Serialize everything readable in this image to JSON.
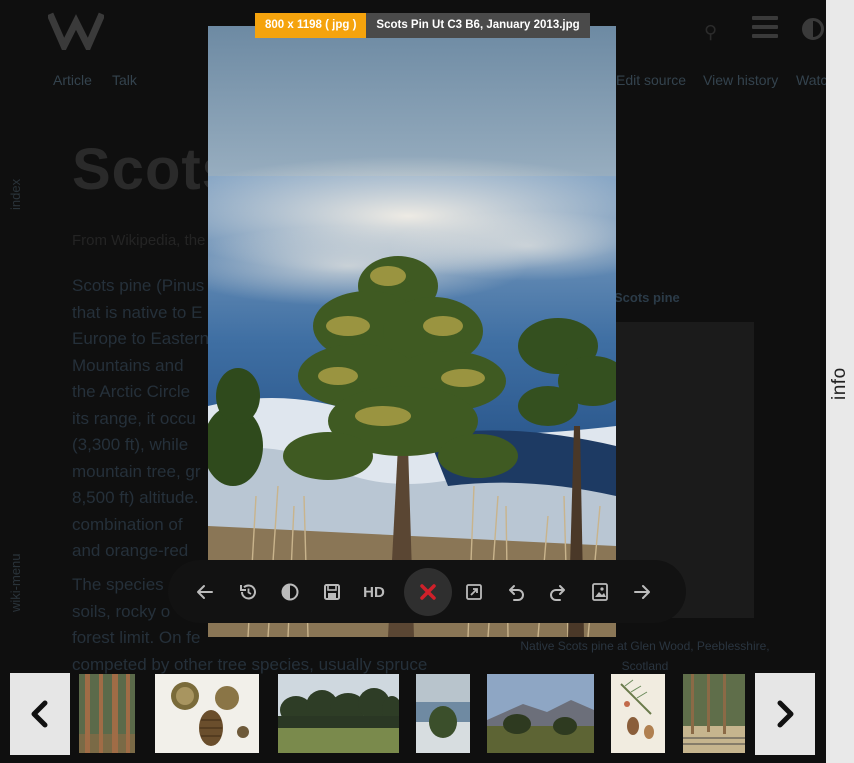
{
  "wiki": {
    "tabs": [
      {
        "label": "Article"
      },
      {
        "label": "Talk"
      },
      {
        "label": "Edit source"
      },
      {
        "label": "View history"
      },
      {
        "label": "Watch"
      }
    ],
    "side_labels": {
      "index": "index",
      "wiki_menu": "wiki-menu"
    },
    "title": "Scots pine",
    "from": "From Wikipedia, the",
    "paragraph1": [
      "Scots pine (Pinus",
      "that is native to E",
      "Europe to Eastern",
      "Mountains and",
      "the Arctic Circle",
      "its range, it occu",
      "(3,300 ft), while",
      "mountain tree, gr",
      "8,500 ft) altitude.",
      "combination of",
      "and orange-red"
    ],
    "paragraph2": [
      "The species",
      "soils, rocky o",
      "forest limit. On fe",
      "competed by other tree species, usually spruce"
    ],
    "infobox_title": "Scots pine",
    "caption_line1": "Native Scots pine at Glen Wood, Peeblesshire,",
    "caption_line2": "Scotland"
  },
  "viewer": {
    "dimensions": "800 x 1198 ( jpg )",
    "filename": "Scots Pin Ut C3 B6, January 2013.jpg",
    "toolbar": {
      "prev": "arrow-left-icon",
      "reset": "history-icon",
      "contrast": "contrast-icon",
      "save": "save-icon",
      "hd": "HD",
      "close": "close-icon",
      "open": "open-external-icon",
      "rotate_left": "rotate-left-icon",
      "rotate_right": "rotate-right-icon",
      "image": "image-icon",
      "next": "arrow-right-icon"
    },
    "close_color": "#d0202a",
    "accent": "#f5a30d"
  },
  "info_tab": "info",
  "thumbnails": [
    "forest-trunks",
    "pine-cones",
    "pine-grove",
    "lake-winter",
    "heath-mountain",
    "botanical-plate",
    "pine-forest-fence"
  ]
}
